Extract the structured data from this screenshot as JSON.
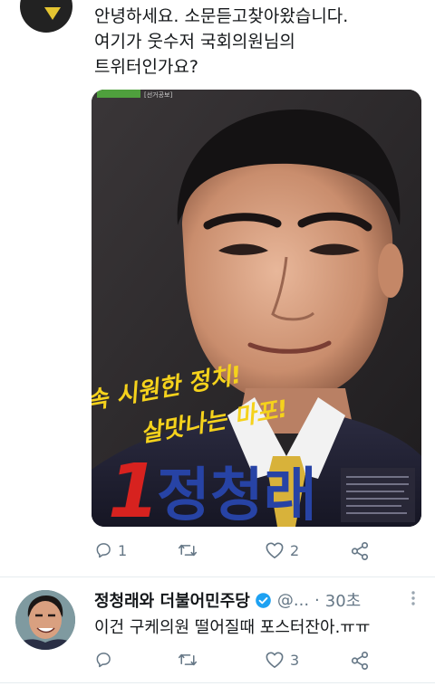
{
  "tweet": {
    "lines": [
      "안녕하세요. 소문듣고찾아왔습니다.",
      "여기가 웃수저 국회의원님의",
      "트위터인가요?"
    ],
    "poster": {
      "header_tag": "[선거공보]",
      "slogan_line1": "속 시원한 정치!",
      "slogan_line2": "살맛나는 마포!",
      "number": "1",
      "candidate_name": "정청래"
    },
    "actions": {
      "reply_count": "1",
      "retweet_count": "",
      "like_count": "2"
    }
  },
  "reply": {
    "display_name": "정청래와 더불어민주당",
    "handle": "@...",
    "separator": "·",
    "time": "30초",
    "text": "이건 구케의원 떨어질때 포스터잔아.ㅠㅠ",
    "actions": {
      "reply_count": "",
      "retweet_count": "",
      "like_count": "3"
    }
  },
  "colors": {
    "text": "#14171a",
    "muted": "#657786",
    "verified": "#1da1f2",
    "poster_red": "#d7221f",
    "poster_blue": "#2743a5",
    "poster_yellow": "#f5d21c"
  }
}
